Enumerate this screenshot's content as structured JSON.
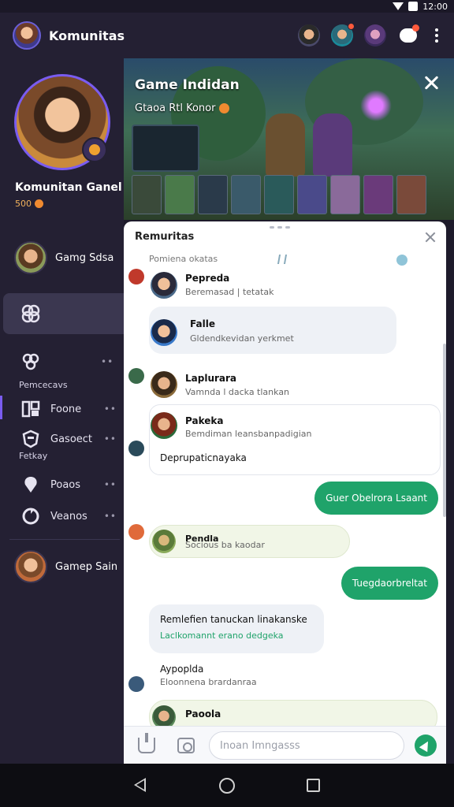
{
  "status": {
    "time": "12:00"
  },
  "app_bar": {
    "title": "Komunitas"
  },
  "sidebar": {
    "profile_name": "Komunitan Ganel",
    "profile_sub": "500",
    "user_top": "Gamg Sdsa",
    "section_1": "Pemcecavs",
    "section_2": "Fetkay",
    "rows": [
      {
        "label": "Foone"
      },
      {
        "label": "Gasoect"
      },
      {
        "label": "Poaos"
      },
      {
        "label": "Veanos"
      }
    ],
    "user_bottom": "Gamep Sain"
  },
  "banner": {
    "title": "Game Indidan",
    "subtitle": "Gtaoa Rtl Konor"
  },
  "chat": {
    "title": "Remuritas",
    "subheader": "Pomiena okatas",
    "messages": [
      {
        "name": "Pepreda",
        "text": "Beremasad | tetatak"
      },
      {
        "name": "Falle",
        "text": "Gldendkevidan yerkmet"
      },
      {
        "name": "Laplurara",
        "text": "Vamnda l dacka tlankan"
      },
      {
        "name": "Pakeka",
        "text": "Bemdiman leansbanpadigian"
      },
      {
        "name": "",
        "text": "Deprupaticnayaka"
      },
      {
        "name": "Pendla",
        "text": "Socious ba kaodar"
      },
      {
        "name": "Remlefien tanuckan linakanske",
        "text": "Laclkomannt erano dedgeka"
      },
      {
        "name": "Aypoplda",
        "text": "Eloonnena brardanraa"
      },
      {
        "name": "Paoola",
        "text": ""
      }
    ],
    "outgoing": [
      "Guer Obelrora Lsaant",
      "Tuegdaorbreltat"
    ],
    "input_placeholder": "Inoan Imngasss"
  },
  "colors": {
    "accent": "#7a5cf0",
    "send_green": "#1fa36a",
    "notification": "#ff5a3c"
  }
}
